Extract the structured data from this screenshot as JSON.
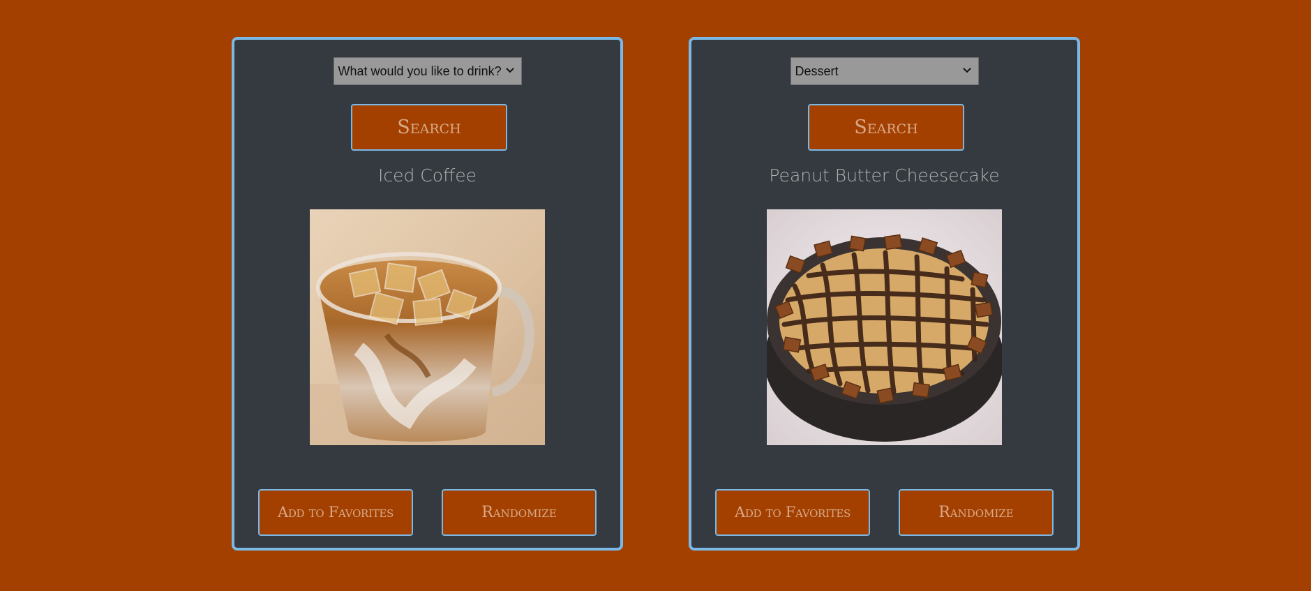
{
  "drink_card": {
    "select": {
      "selected": "What would you like to drink?"
    },
    "search_label": "Search",
    "item_title": "Iced Coffee",
    "image_subject": "iced-coffee-photo",
    "favorite_label": "Add to Favorites",
    "randomize_label": "Randomize"
  },
  "food_card": {
    "select": {
      "selected": "Dessert"
    },
    "search_label": "Search",
    "item_title": "Peanut Butter Cheesecake",
    "image_subject": "peanut-butter-cheesecake-photo",
    "favorite_label": "Add to Favorites",
    "randomize_label": "Randomize"
  },
  "colors": {
    "background": "#a34000",
    "card": "#343a40",
    "card_border": "#7ab8e6",
    "button": "#a34000",
    "button_text": "#d9a98a",
    "title_text": "#b3b3b3",
    "select_bg": "#999999"
  },
  "icons": {
    "dropdown": "chevron-down-icon"
  }
}
